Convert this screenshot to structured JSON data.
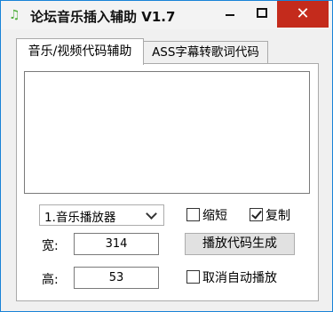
{
  "window": {
    "title": "论坛音乐插入辅助 V1.7",
    "icon": "music-note-icon",
    "close_glyph": "✕",
    "accent": "#c42b1c"
  },
  "tabs": [
    {
      "label": "音乐/视频代码辅助"
    },
    {
      "label": "ASS字幕转歌词代码"
    }
  ],
  "player_select": {
    "value": "1.音乐播放器"
  },
  "options": {
    "shorten_label": "缩短",
    "shorten_checked": false,
    "copy_label": "复制",
    "copy_checked": true,
    "no_autoplay_label": "取消自动播放",
    "no_autoplay_checked": false
  },
  "width_field": {
    "label": "宽:",
    "value": "314"
  },
  "height_field": {
    "label": "高:",
    "value": "53"
  },
  "generate_button": {
    "label": "播放代码生成"
  }
}
